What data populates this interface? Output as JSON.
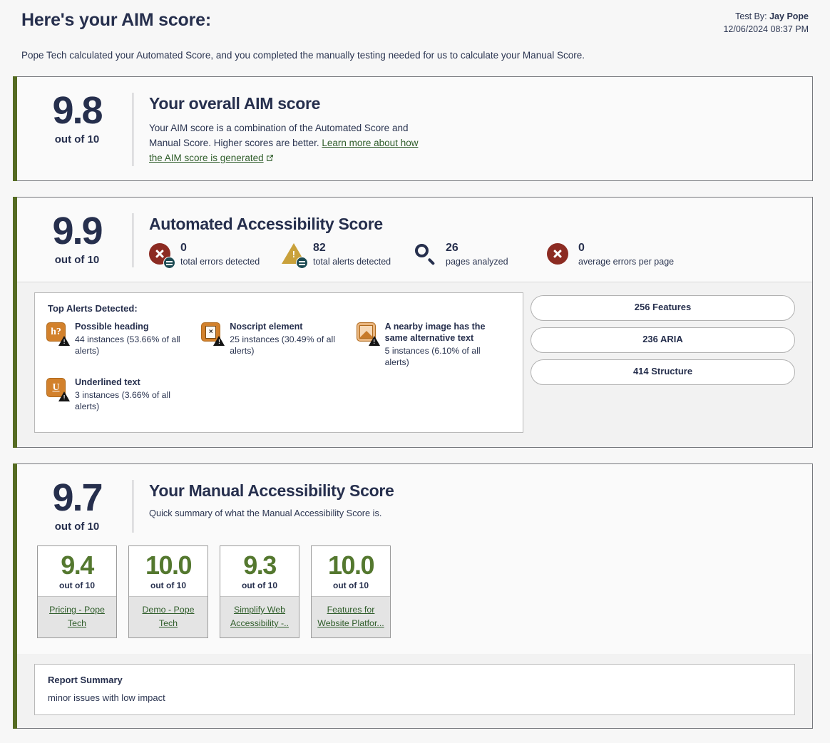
{
  "header": {
    "title": "Here's your AIM score:",
    "test_by_label": "Test By:",
    "tester_name": "Jay Pope",
    "timestamp": "12/06/2024 08:37 PM",
    "intro": "Pope Tech calculated your Automated Score, and you completed the manually testing needed for us to calculate your Manual Score."
  },
  "overall": {
    "score": "9.8",
    "out_of": "out of 10",
    "heading": "Your overall AIM score",
    "description": "Your AIM score is a combination of the Automated Score and Manual Score. Higher scores are better. ",
    "link_text": "Learn more about how the AIM score is generated"
  },
  "automated": {
    "score": "9.9",
    "out_of": "out of 10",
    "heading": "Automated Accessibility Score",
    "stats": [
      {
        "value": "0",
        "label": "total errors detected",
        "icon": "error-circle-icon"
      },
      {
        "value": "82",
        "label": "total alerts detected",
        "icon": "alert-triangle-icon"
      },
      {
        "value": "26",
        "label": "pages analyzed",
        "icon": "magnifier-icon"
      },
      {
        "value": "0",
        "label": "average errors per page",
        "icon": "error-circle-icon"
      }
    ],
    "alerts_title": "Top Alerts Detected:",
    "alerts": [
      {
        "name": "Possible heading",
        "count": "44 instances (53.66% of all alerts)",
        "icon": "heading-question-icon"
      },
      {
        "name": "Noscript element",
        "count": "25 instances (30.49% of all alerts)",
        "icon": "noscript-document-icon"
      },
      {
        "name": "A nearby image has the same alternative text",
        "count": "5 instances (6.10% of all alerts)",
        "icon": "image-alt-icon"
      },
      {
        "name": "Underlined text",
        "count": "3 instances (3.66% of all alerts)",
        "icon": "underline-icon"
      }
    ],
    "pills": [
      {
        "label": "256 Features"
      },
      {
        "label": "236 ARIA"
      },
      {
        "label": "414 Structure"
      }
    ]
  },
  "manual": {
    "score": "9.7",
    "out_of": "out of 10",
    "heading": "Your Manual Accessibility Score",
    "description": "Quick summary of what the Manual Accessibility Score is.",
    "cards": [
      {
        "score": "9.4",
        "out_of": "out of 10",
        "page": "Pricing - Pope Tech"
      },
      {
        "score": "10.0",
        "out_of": "out of 10",
        "page": "Demo - Pope Tech"
      },
      {
        "score": "9.3",
        "out_of": "out of 10",
        "page": "Simplify Web Accessibility -.."
      },
      {
        "score": "10.0",
        "out_of": "out of 10",
        "page": "Features for Website Platfor..."
      }
    ],
    "summary_title": "Report Summary",
    "summary_text": "minor issues with low impact"
  },
  "colors": {
    "accent_green": "#556b22",
    "link_green": "#2f5d2a",
    "score_green": "#54782f",
    "error_red": "#8c2b22",
    "alert_gold": "#c9a13b",
    "badge_teal": "#1c4a52",
    "icon_orange": "#d2812c",
    "text_navy": "#262f4d"
  }
}
